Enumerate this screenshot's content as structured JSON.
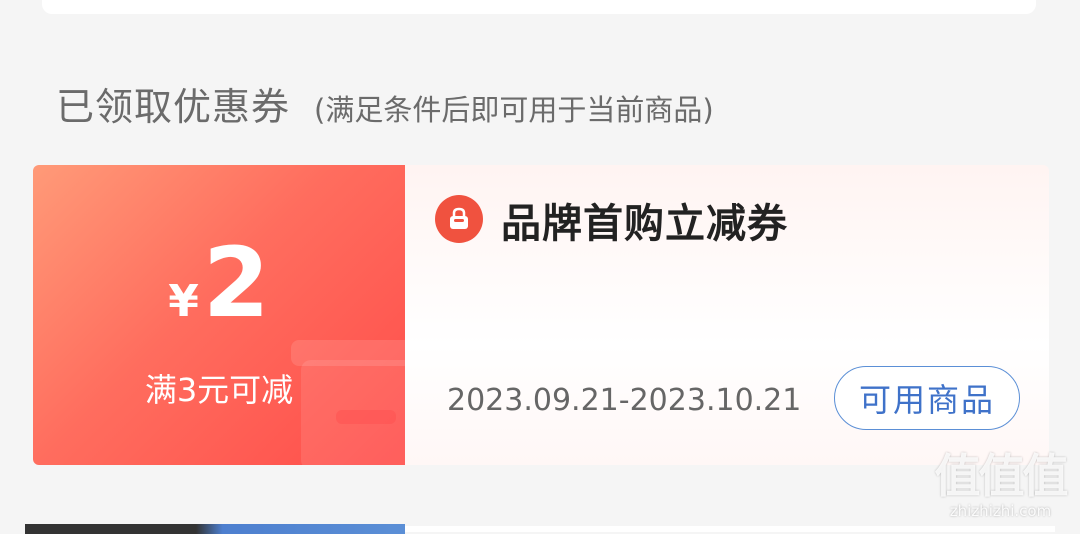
{
  "section": {
    "title": "已领取优惠券",
    "subtitle": "(满足条件后即可用于当前商品)"
  },
  "coupon": {
    "currency": "¥",
    "amount": "2",
    "condition": "满3元可减",
    "title": "品牌首购立减券",
    "validity": "2023.09.21-2023.10.21",
    "button_label": "可用商品",
    "brand_icon": "bag-icon"
  },
  "watermark": {
    "mark": "值值值",
    "site": "zhizhizhi.com"
  },
  "colors": {
    "coupon_red": "#ff5a4f",
    "button_blue": "#3f72c9",
    "icon_red": "#f0523f"
  }
}
